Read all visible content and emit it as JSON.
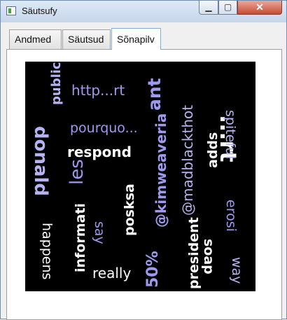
{
  "window": {
    "title": "Säutsufy"
  },
  "controls": {
    "minimize": "▁",
    "maximize": "▢",
    "close": "✕"
  },
  "tabs": [
    {
      "label": "Andmed"
    },
    {
      "label": "Säutsud"
    },
    {
      "label": "Sõnapilv",
      "selected": true
    }
  ],
  "word_cloud": {
    "colors": {
      "light": "#b7b3f2",
      "white": "#ffffff",
      "lavender": "#9f9af0",
      "background": "#000000"
    },
    "words": [
      {
        "text": "public",
        "color": "light"
      },
      {
        "text": "http...rt",
        "color": "lavender"
      },
      {
        "text": "ant",
        "color": "lavender"
      },
      {
        "text": "...rt",
        "color": "white"
      },
      {
        "text": "pourquo...",
        "color": "lavender"
      },
      {
        "text": "respond",
        "color": "white"
      },
      {
        "text": "donald",
        "color": "light"
      },
      {
        "text": "happens",
        "color": "white"
      },
      {
        "text": "les",
        "color": "lavender"
      },
      {
        "text": "informati",
        "color": "white"
      },
      {
        "text": "say",
        "color": "lavender"
      },
      {
        "text": "posksa",
        "color": "white"
      },
      {
        "text": "@kimweaveria",
        "color": "lavender"
      },
      {
        "text": "@madblackthot",
        "color": "light"
      },
      {
        "text": "adds",
        "color": "white"
      },
      {
        "text": "spiteful",
        "color": "light"
      },
      {
        "text": "erosi",
        "color": "lavender"
      },
      {
        "text": "president",
        "color": "white"
      },
      {
        "text": "soap",
        "color": "white"
      },
      {
        "text": "way",
        "color": "light"
      },
      {
        "text": "really",
        "color": "white"
      },
      {
        "text": "50%",
        "color": "lavender"
      }
    ]
  }
}
